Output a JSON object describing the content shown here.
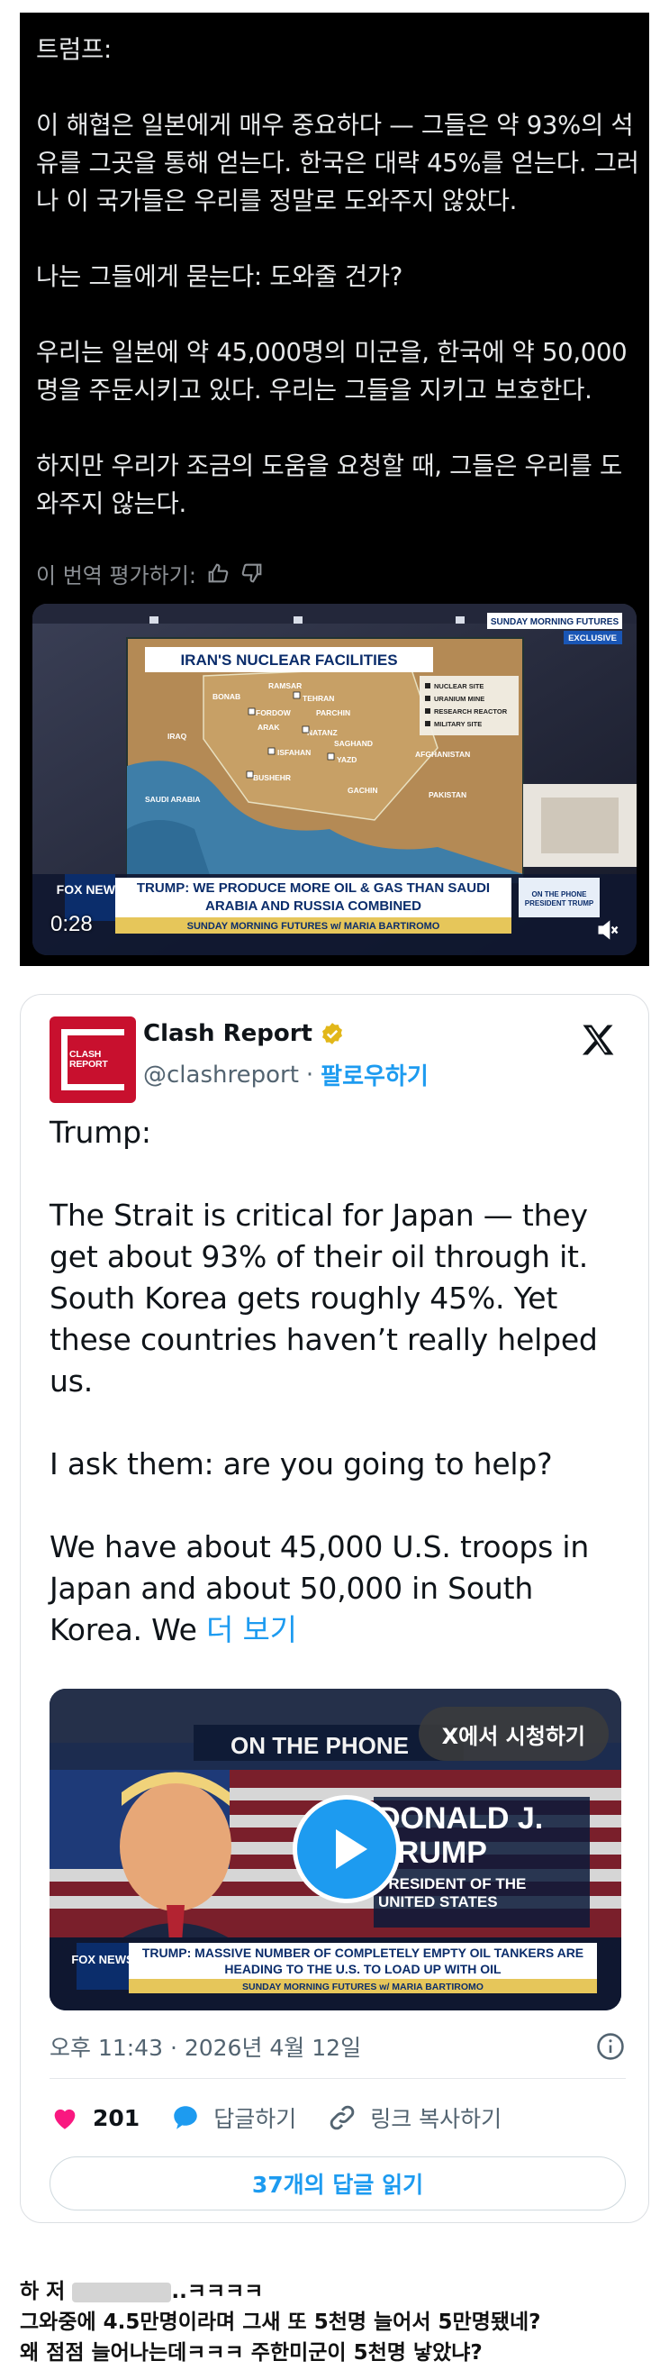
{
  "translated_post": {
    "body": "트럼프:\n\n이 해협은 일본에게 매우 중요하다 — 그들은 약 93%의 석유를 그곳을 통해 얻는다. 한국은 대략 45%를 얻는다. 그러나 이 국가들은 우리를 정말로 도와주지 않았다.\n\n나는 그들에게 묻는다: 도와줄 건가?\n\n우리는 일본에 약 45,000명의 미군을, 한국에 약 50,000명을 주둔시키고 있다. 우리는 그들을 지키고 보호한다.\n\n하지만 우리가 조금의 도움을 요청할 때, 그들은 우리를 도와주지 않는다.",
    "rate_label": "이 번역 평가하기:",
    "video": {
      "map_title": "IRAN'S NUCLEAR FACILITIES",
      "show_badge": "SUNDAY MORNING FUTURES",
      "exclusive": "EXCLUSIVE",
      "legend": [
        "NUCLEAR SITE",
        "URANIUM MINE",
        "RESEARCH REACTOR",
        "MILITARY SITE"
      ],
      "places": [
        "RAMSAR",
        "TEHRAN",
        "BONAB",
        "FORDOW",
        "PARCHIN",
        "ARAK",
        "NATANZ",
        "ISFAHAN",
        "SAGHAND",
        "YAZD",
        "BUSHEHR",
        "GACHIN",
        "IRAQ",
        "SAUDI ARABIA",
        "AFGHANISTAN",
        "PAKISTAN"
      ],
      "network": "FOX NEWS",
      "headline": "TRUMP: WE PRODUCE MORE OIL & GAS THAN SAUDI ARABIA AND RUSSIA COMBINED",
      "subline": "SUNDAY MORNING FUTURES w/ MARIA BARTIROMO",
      "phone_tag": "ON THE PHONE PRESIDENT TRUMP",
      "time": "0:28"
    }
  },
  "tweet": {
    "name": "Clash Report",
    "logo_text": "CLASH\nREPORT",
    "handle": "@clashreport",
    "separator": "·",
    "follow_label": "팔로우하기",
    "body": "Trump:\n\nThe Strait is critical for Japan — they get about 93% of their oil through it. South Korea gets roughly 45%. Yet these countries haven’t really helped us.\n\nI ask them: are you going to help?\n\nWe have about 45,000 U.S. troops in Japan and about 50,000 in South Korea. We ",
    "more_label": "더 보기",
    "video": {
      "watch_label": "X에서 시청하기",
      "wall_text": "ON THE PHONE",
      "name_text": "DONALD J. TRUMP",
      "title_text": "PRESIDENT OF THE UNITED STATES",
      "network": "FOX NEWS",
      "headline": "TRUMP: MASSIVE NUMBER OF COMPLETELY EMPTY OIL TANKERS ARE HEADING TO THE U.S. TO LOAD UP WITH OIL",
      "subline": "SUNDAY MORNING FUTURES w/ MARIA BARTIROMO"
    },
    "timestamp": "오후 11:43 · 2026년 4월 12일",
    "like_count": "201",
    "reply_label": "답글하기",
    "copy_link_label": "링크 복사하기",
    "read_replies_label": "37개의 답글 읽기"
  },
  "comment": {
    "prefix": "하 저",
    "suffix": "..ㅋㅋㅋㅋ",
    "line2": "그와중에 4.5만명이라며 그새 또 5천명 늘어서 5만명됐네?",
    "line3": "왜 점점 늘어나는데ㅋㅋㅋ 주한미군이 5천명 낳았냐?"
  },
  "colors": {
    "accent": "#1d9bf0",
    "like": "#f91880",
    "brand_red": "#c8102e",
    "fox_blue": "#0b2d6b"
  }
}
